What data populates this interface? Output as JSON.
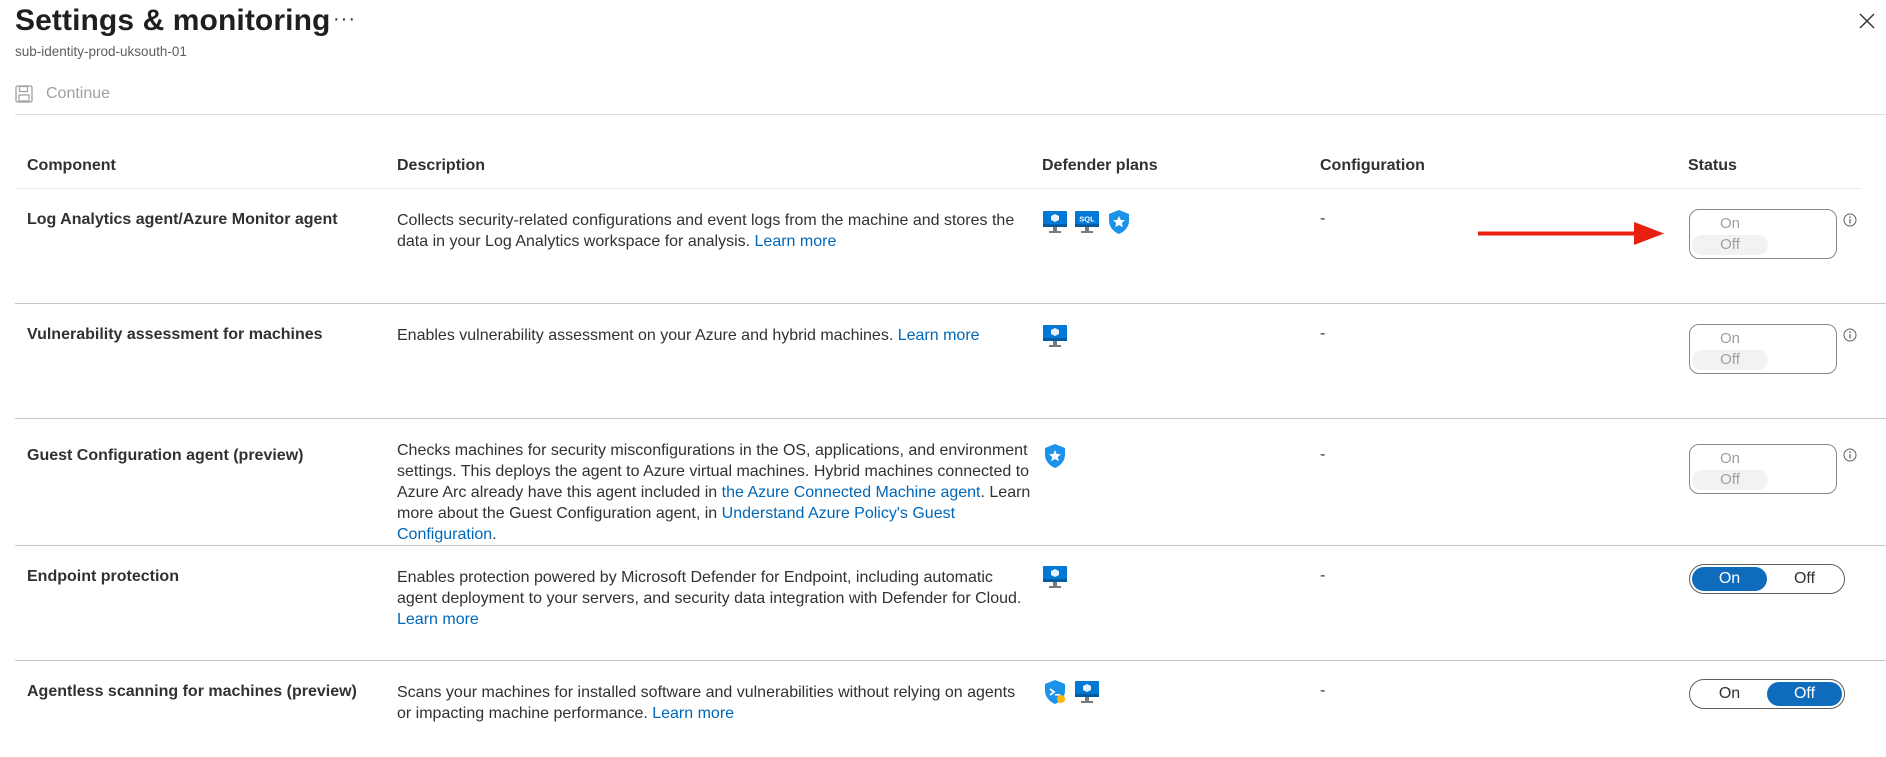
{
  "header": {
    "title": "Settings & monitoring",
    "more_label": "···",
    "subtitle": "sub-identity-prod-uksouth-01",
    "close_icon": "close-icon"
  },
  "toolbar": {
    "continue_label": "Continue",
    "continue_icon": "save-icon"
  },
  "table": {
    "columns": [
      "Component",
      "Description",
      "Defender plans",
      "Configuration",
      "Status"
    ],
    "rows": [
      {
        "component": "Log Analytics agent/Azure Monitor agent",
        "description_text": "Collects security-related configurations and event logs from the machine and stores the data in your Log Analytics workspace for analysis.",
        "description_link": "Learn more",
        "plans": [
          "server-icon",
          "sql-server-icon",
          "shield-star-icon"
        ],
        "configuration": "-",
        "status": {
          "on_label": "On",
          "off_label": "Off",
          "selected": "Off",
          "disabled": true
        }
      },
      {
        "component": "Vulnerability assessment for machines",
        "description_text": "Enables vulnerability assessment on your Azure and hybrid machines.",
        "description_link": "Learn more",
        "plans": [
          "server-icon"
        ],
        "configuration": "-",
        "status": {
          "on_label": "On",
          "off_label": "Off",
          "selected": "Off",
          "disabled": true
        }
      },
      {
        "component": "Guest Configuration agent (preview)",
        "description_part1": "Checks machines for security misconfigurations in the OS, applications, and environment settings. This deploys the agent to Azure virtual machines. Hybrid machines connected to Azure Arc already have this agent included in",
        "description_link1": "the Azure Connected Machine agent",
        "description_part2": ". Learn more about the Guest Configuration agent, in",
        "description_link2": "Understand Azure Policy's Guest Configuration",
        "description_part3": ".",
        "plans": [
          "shield-star-icon"
        ],
        "configuration": "-",
        "status": {
          "on_label": "On",
          "off_label": "Off",
          "selected": "Off",
          "disabled": true
        }
      },
      {
        "component": "Endpoint protection",
        "description_text": "Enables protection powered by Microsoft Defender for Endpoint, including automatic agent deployment to your servers, and security data integration with Defender for Cloud.",
        "description_link": "Learn more",
        "plans": [
          "server-icon"
        ],
        "configuration": "-",
        "status": {
          "on_label": "On",
          "off_label": "Off",
          "selected": "On",
          "disabled": false
        }
      },
      {
        "component": "Agentless scanning for machines (preview)",
        "description_text": "Scans your machines for installed software and vulnerabilities without relying on agents or impacting machine performance.",
        "description_link": "Learn more",
        "plans": [
          "shield-cspm-icon",
          "server-icon"
        ],
        "configuration": "-",
        "status": {
          "on_label": "On",
          "off_label": "Off",
          "selected": "Off",
          "disabled": false
        }
      }
    ]
  },
  "annotation": {
    "arrow_color": "#e8200f"
  },
  "colors": {
    "accent": "#0f6cbd",
    "link": "#0067b8",
    "disabled_text": "#a19f9d"
  }
}
